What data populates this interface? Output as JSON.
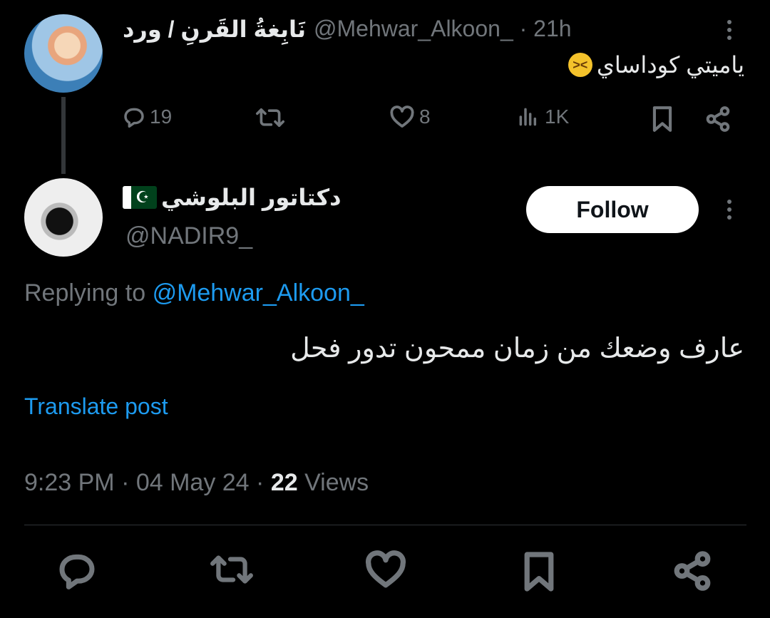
{
  "parent_tweet": {
    "display_name": "نَابِغةُ القَرنِ / ورد",
    "handle": "@Mehwar_Alkoon_",
    "time": "· 21h",
    "text": "ياميتي كوداساي",
    "emoji": "tired-face-emoji",
    "actions": {
      "replies": "19",
      "likes": "8",
      "views": "1K"
    }
  },
  "reply_tweet": {
    "display_name": "دكتاتور البلوشي",
    "flag": "pakistan-flag",
    "handle": "@NADIR9_",
    "follow_label": "Follow",
    "replying_prefix": "Replying to",
    "replying_mention": "@Mehwar_Alkoon_",
    "text": "عارف وضعك من زمان ممحون تدور فحل",
    "translate_label": "Translate post",
    "timestamp": "9:23 PM · 04 May 24 · ",
    "views_count": "22",
    "views_label": " Views"
  },
  "colors": {
    "background": "#000000",
    "primary_text": "#e7e9ea",
    "secondary_text": "#71767b",
    "accent": "#1d9bf0",
    "follow_button_bg": "#ffffff"
  }
}
